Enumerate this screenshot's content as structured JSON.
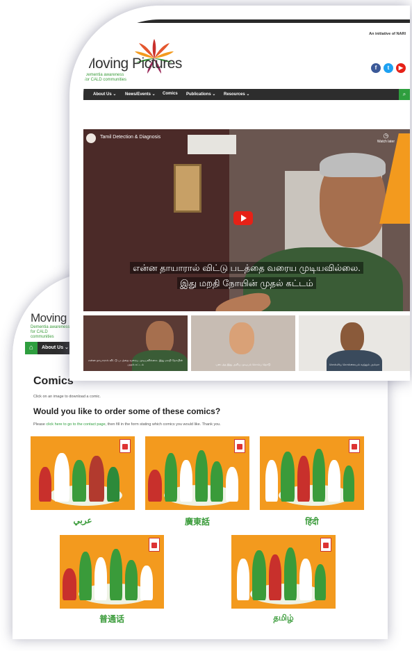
{
  "front": {
    "initiative": "An initiative of NARI",
    "brand": "Moving Pictures",
    "brand_sub_1": "Dementia awareness",
    "brand_sub_2": "for CALD communities",
    "social": [
      {
        "name": "facebook-icon",
        "glyph": "f",
        "color": "#3b5998"
      },
      {
        "name": "twitter-icon",
        "glyph": "t",
        "color": "#1da1f2"
      },
      {
        "name": "youtube-icon",
        "glyph": "▶",
        "color": "#e62117"
      }
    ],
    "nav": {
      "items": [
        "About Us ⌄",
        "News/Events ⌄",
        "Comics",
        "Publications ⌄",
        "Resources ⌄"
      ]
    },
    "video": {
      "title": "Tamil Detection & Diagnosis",
      "watch_later": "Watch later",
      "caption_line1": "என்ன தாயாரால் விட்டு படத்தை வரைய முடியவில்லை.",
      "caption_line2": "இது மறதி நோயின் முதல் கட்டம்"
    },
    "thumbs": [
      {
        "caption": "என்ன தாயாரால் விட்டு படத்தை வரைய முடியவில்லை. இது மறதி நோயின் முதல் கட்டம்"
      },
      {
        "caption": "படைத்த இது அறிய முடியும் கொம்ப தொடு"
      },
      {
        "caption": "சொல்லிய கொல்லையும் வந்தும் அம்மா"
      }
    ]
  },
  "back": {
    "brand": "Moving Pic",
    "brand_sub_1": "Dementia awareness",
    "brand_sub_2": "for CALD communities",
    "nav_item": "About Us ⌄",
    "title": "Comics",
    "hint": "Click on an image to download a comic.",
    "order_title": "Would you like to order some of these comics?",
    "order_text_before": "Please ",
    "order_link": "click here to go to the contact page",
    "order_text_after": ", then fill in the form stating which comics you would like. Thank you.",
    "comics": [
      {
        "label": "عربي"
      },
      {
        "label": "廣東話"
      },
      {
        "label": "हिंदी"
      },
      {
        "label": "普通话"
      },
      {
        "label": "தமிழ்"
      }
    ]
  },
  "colors": {
    "accent_green": "#2e9e3e",
    "nav_dark": "#2d2d2d",
    "comic_orange": "#f39a1e"
  }
}
